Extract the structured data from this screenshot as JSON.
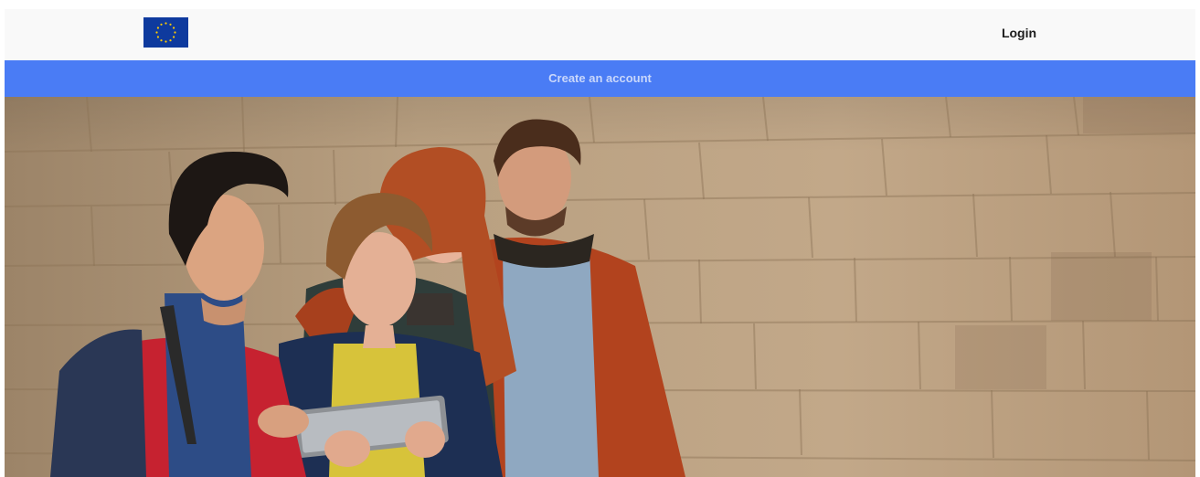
{
  "header": {
    "logo_icon": "eu-flag-icon",
    "login_label": "Login"
  },
  "cta": {
    "create_account_label": "Create an account"
  },
  "hero": {
    "image_subject": "hero-photo-students"
  },
  "colors": {
    "header_bg": "#f9f9f9",
    "accent_bar": "#4a7cf5",
    "accent_bar_text": "#c9d7fb",
    "flag_blue": "#0e3a9e",
    "flag_stars": "#ffcc00",
    "login_text": "#1d1d1d"
  }
}
